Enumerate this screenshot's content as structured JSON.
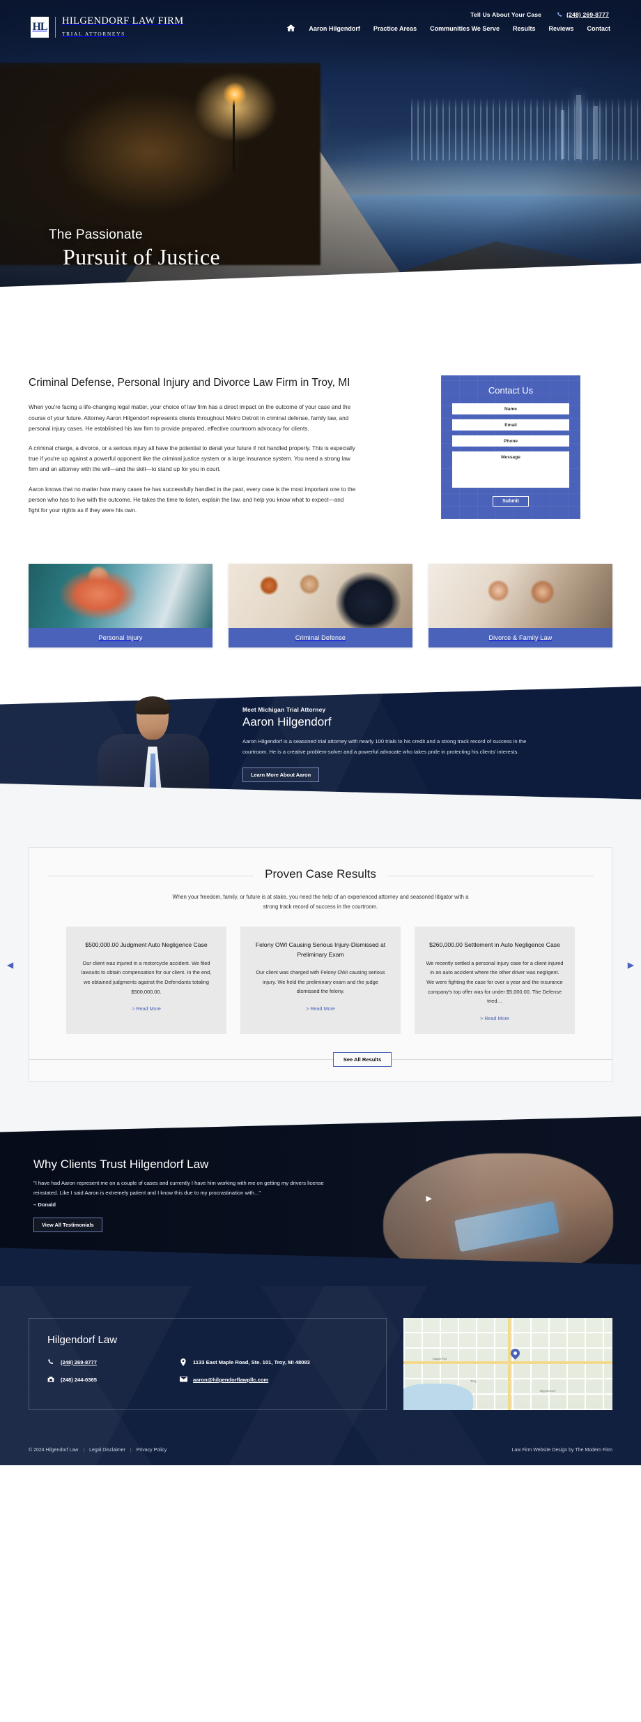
{
  "header": {
    "brand": {
      "mark": "HL",
      "name": "HILGENDORF LAW FIRM",
      "sub": "TRIAL ATTORNEYS"
    },
    "tagline": "Tell Us About Your Case",
    "phone": "(248) 269-8777",
    "nav": [
      {
        "label": "Aaron Hilgendorf"
      },
      {
        "label": "Practice Areas"
      },
      {
        "label": "Communities We Serve"
      },
      {
        "label": "Results"
      },
      {
        "label": "Reviews"
      },
      {
        "label": "Contact"
      }
    ]
  },
  "hero": {
    "line1": "The Passionate",
    "line2": "Pursuit of Justice"
  },
  "intro": {
    "heading": "Criminal Defense, Personal Injury and Divorce Law Firm in Troy, MI",
    "paragraphs": [
      "When you're facing a life-changing legal matter, your choice of law firm has a direct impact on the outcome of your case and the course of your future. Attorney Aaron Hilgendorf represents clients throughout Metro Detroit in criminal defense, family law, and personal injury cases. He established his law firm to provide prepared, effective courtroom advocacy for clients.",
      "A criminal charge, a divorce, or a serious injury all have the potential to derail your future if not handled properly. This is especially true if you're up against a powerful opponent like the criminal justice system or a large insurance system. You need a strong law firm and an attorney with the will—and the skill—to stand up for you in court.",
      "Aaron knows that no matter how many cases he has successfully handled in the past, every case is the most important one to the person who has to live with the outcome. He takes the time to listen, explain the law, and help you know what to expect—and fight for your rights as if they were his own."
    ]
  },
  "contact_form": {
    "title": "Contact Us",
    "fields": [
      {
        "label": "Name"
      },
      {
        "label": "Email"
      },
      {
        "label": "Phone"
      },
      {
        "label": "Message"
      }
    ],
    "submit_label": "Submit"
  },
  "practice_cards": [
    {
      "label": "Personal Injury",
      "image": "personal-injury-handshake-photo"
    },
    {
      "label": "Criminal Defense",
      "image": "criminal-defense-consultation-photo"
    },
    {
      "label": "Divorce & Family Law",
      "image": "divorce-family-law-father-daughter-photo"
    }
  ],
  "attorney": {
    "kicker": "Meet Michigan Trial Attorney",
    "name": "Aaron Hilgendorf",
    "body": "Aaron Hilgendorf is a seasoned trial attorney with nearly 100 trials to his credit and a strong track record of success in the courtroom. He is a creative problem-solver and a powerful advocate who takes pride in protecting his clients' interests.",
    "button_label": "Learn More About Aaron",
    "photo": "attorney-portrait-photo"
  },
  "results": {
    "title": "Proven Case Results",
    "subtitle": "When your freedom, family, or future is at stake, you need the help of an experienced attorney and seasoned litigator with a strong track record of success in the courtroom.",
    "prev_arrow": "◀",
    "next_arrow": "▶",
    "cards": [
      {
        "title": "$500,000.00 Judgment Auto Negligence Case",
        "body": "Our client was injured in a motorcycle accident. We filed lawsuits to obtain compensation for our client. In the end, we obtained judgments against the Defendants totaling $500,000.00.",
        "link": "> Read More"
      },
      {
        "title": "Felony OWI Causing Serious Injury-Dismissed at Preliminary Exam",
        "body": "Our client was charged with Felony OWI causing serious injury. We held the preliminary exam and the judge dismissed the felony.",
        "link": "> Read More"
      },
      {
        "title": "$260,000.00 Settlement in Auto Negligence Case",
        "body": "We recently settled a personal injury case for a client injured in an auto accident where the other driver was negligent. We were fighting the case for over a year and the insurance company's top offer was for under $5,000.00. The Defense tried…",
        "link": "> Read More"
      }
    ],
    "see_all_label": "See All Results"
  },
  "testimonials": {
    "title": "Why Clients Trust Hilgendorf Law",
    "quote": "\"I have had Aaron represent me on a couple of cases and currently I have him working with me on getting my drivers license reinstated. Like I said Aaron is extremely patient and I know this due to my procrastination with...\"",
    "author": "– Donald",
    "button_label": "View All Testimonials",
    "next_arrow": "▶"
  },
  "footer": {
    "name": "Hilgendorf Law",
    "phone": "(248) 269-8777",
    "fax": "(248) 244-0365",
    "address": "1133 East Maple Road, Ste. 101, Troy, MI 48083",
    "email": "aaron@hilgendorflawpllc.com",
    "map_labels": [
      "Troy",
      "Maple Rd",
      "Big Beaver"
    ],
    "copyright": "© 2024 Hilgendorf Law",
    "legal_disclaimer": "Legal Disclaimer",
    "privacy_policy": "Privacy Policy",
    "credit": "Law Firm Website Design by The Modern Firm"
  },
  "colors": {
    "navy": "#12203f",
    "deep_navy": "#0d1c3c",
    "accent_blue": "#4a62ba",
    "light_gray": "#f5f6f7",
    "card_gray": "#e9e9e9"
  }
}
